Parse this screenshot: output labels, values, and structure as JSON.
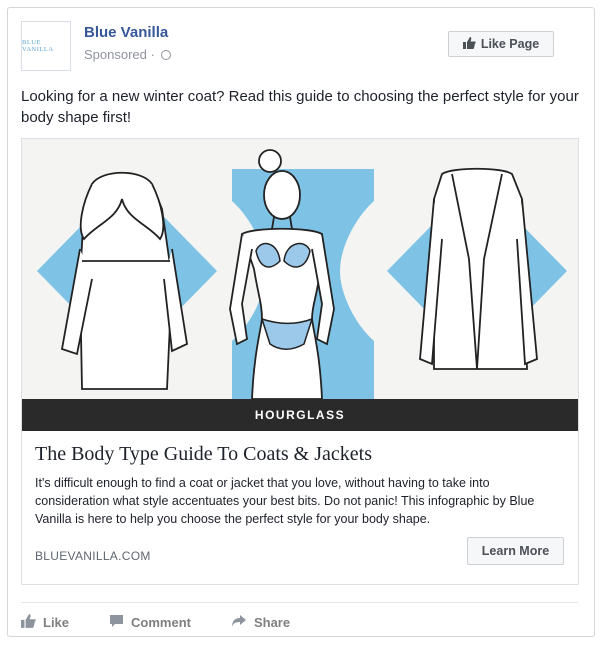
{
  "page": {
    "name": "Blue Vanilla",
    "logo_text": "BLUE VANILLA",
    "sponsored_label": "Sponsored",
    "separator": "·",
    "like_page_button": "Like Page"
  },
  "post": {
    "text": "Looking for a new winter coat? Read this guide to choosing the perfect style for your body shape first!"
  },
  "attachment": {
    "image_caption": "HOURGLASS",
    "title": "The Body Type Guide To Coats & Jackets",
    "description": "It's difficult enough to find a coat or jacket that you love, without having to take into consideration what style accentuates your best bits. Do not panic! This infographic by Blue Vanilla is here to help you choose the perfect style for your body shape.",
    "domain": "BLUEVANILLA.COM",
    "cta_button": "Learn More",
    "colors": {
      "accent_blue": "#7ec3e6",
      "caption_bar": "#2a2a2a"
    }
  },
  "actions": [
    {
      "label": "Like",
      "icon": "thumbs-up-icon"
    },
    {
      "label": "Comment",
      "icon": "comment-icon"
    },
    {
      "label": "Share",
      "icon": "share-icon"
    }
  ],
  "colors": {
    "link_blue": "#365899",
    "muted": "#90949c"
  }
}
